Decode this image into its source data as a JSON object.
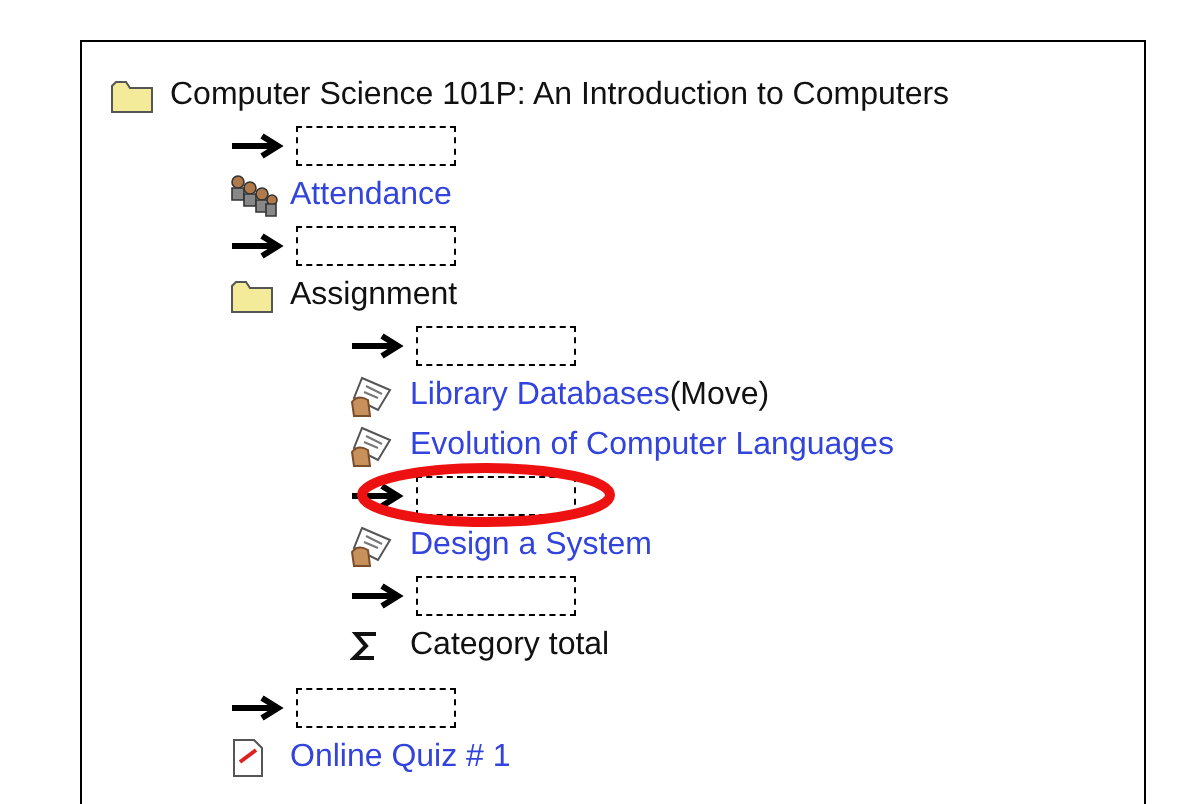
{
  "tree": {
    "kind": "folder",
    "label": "Computer Science 101P: An Introduction to Computers",
    "children": [
      {
        "kind": "drop"
      },
      {
        "kind": "attendance",
        "label": "Attendance"
      },
      {
        "kind": "drop"
      },
      {
        "kind": "folder",
        "label": "Assignment",
        "children": [
          {
            "kind": "drop"
          },
          {
            "kind": "assignment",
            "label": "Library Databases",
            "suffix": "(Move)"
          },
          {
            "kind": "assignment",
            "label": "Evolution of Computer Languages"
          },
          {
            "kind": "drop",
            "circled": true
          },
          {
            "kind": "assignment",
            "label": "Design a System"
          },
          {
            "kind": "drop"
          },
          {
            "kind": "total",
            "label": "Category total"
          }
        ]
      },
      {
        "kind": "drop"
      },
      {
        "kind": "quiz",
        "label": "Online Quiz # 1"
      }
    ]
  }
}
